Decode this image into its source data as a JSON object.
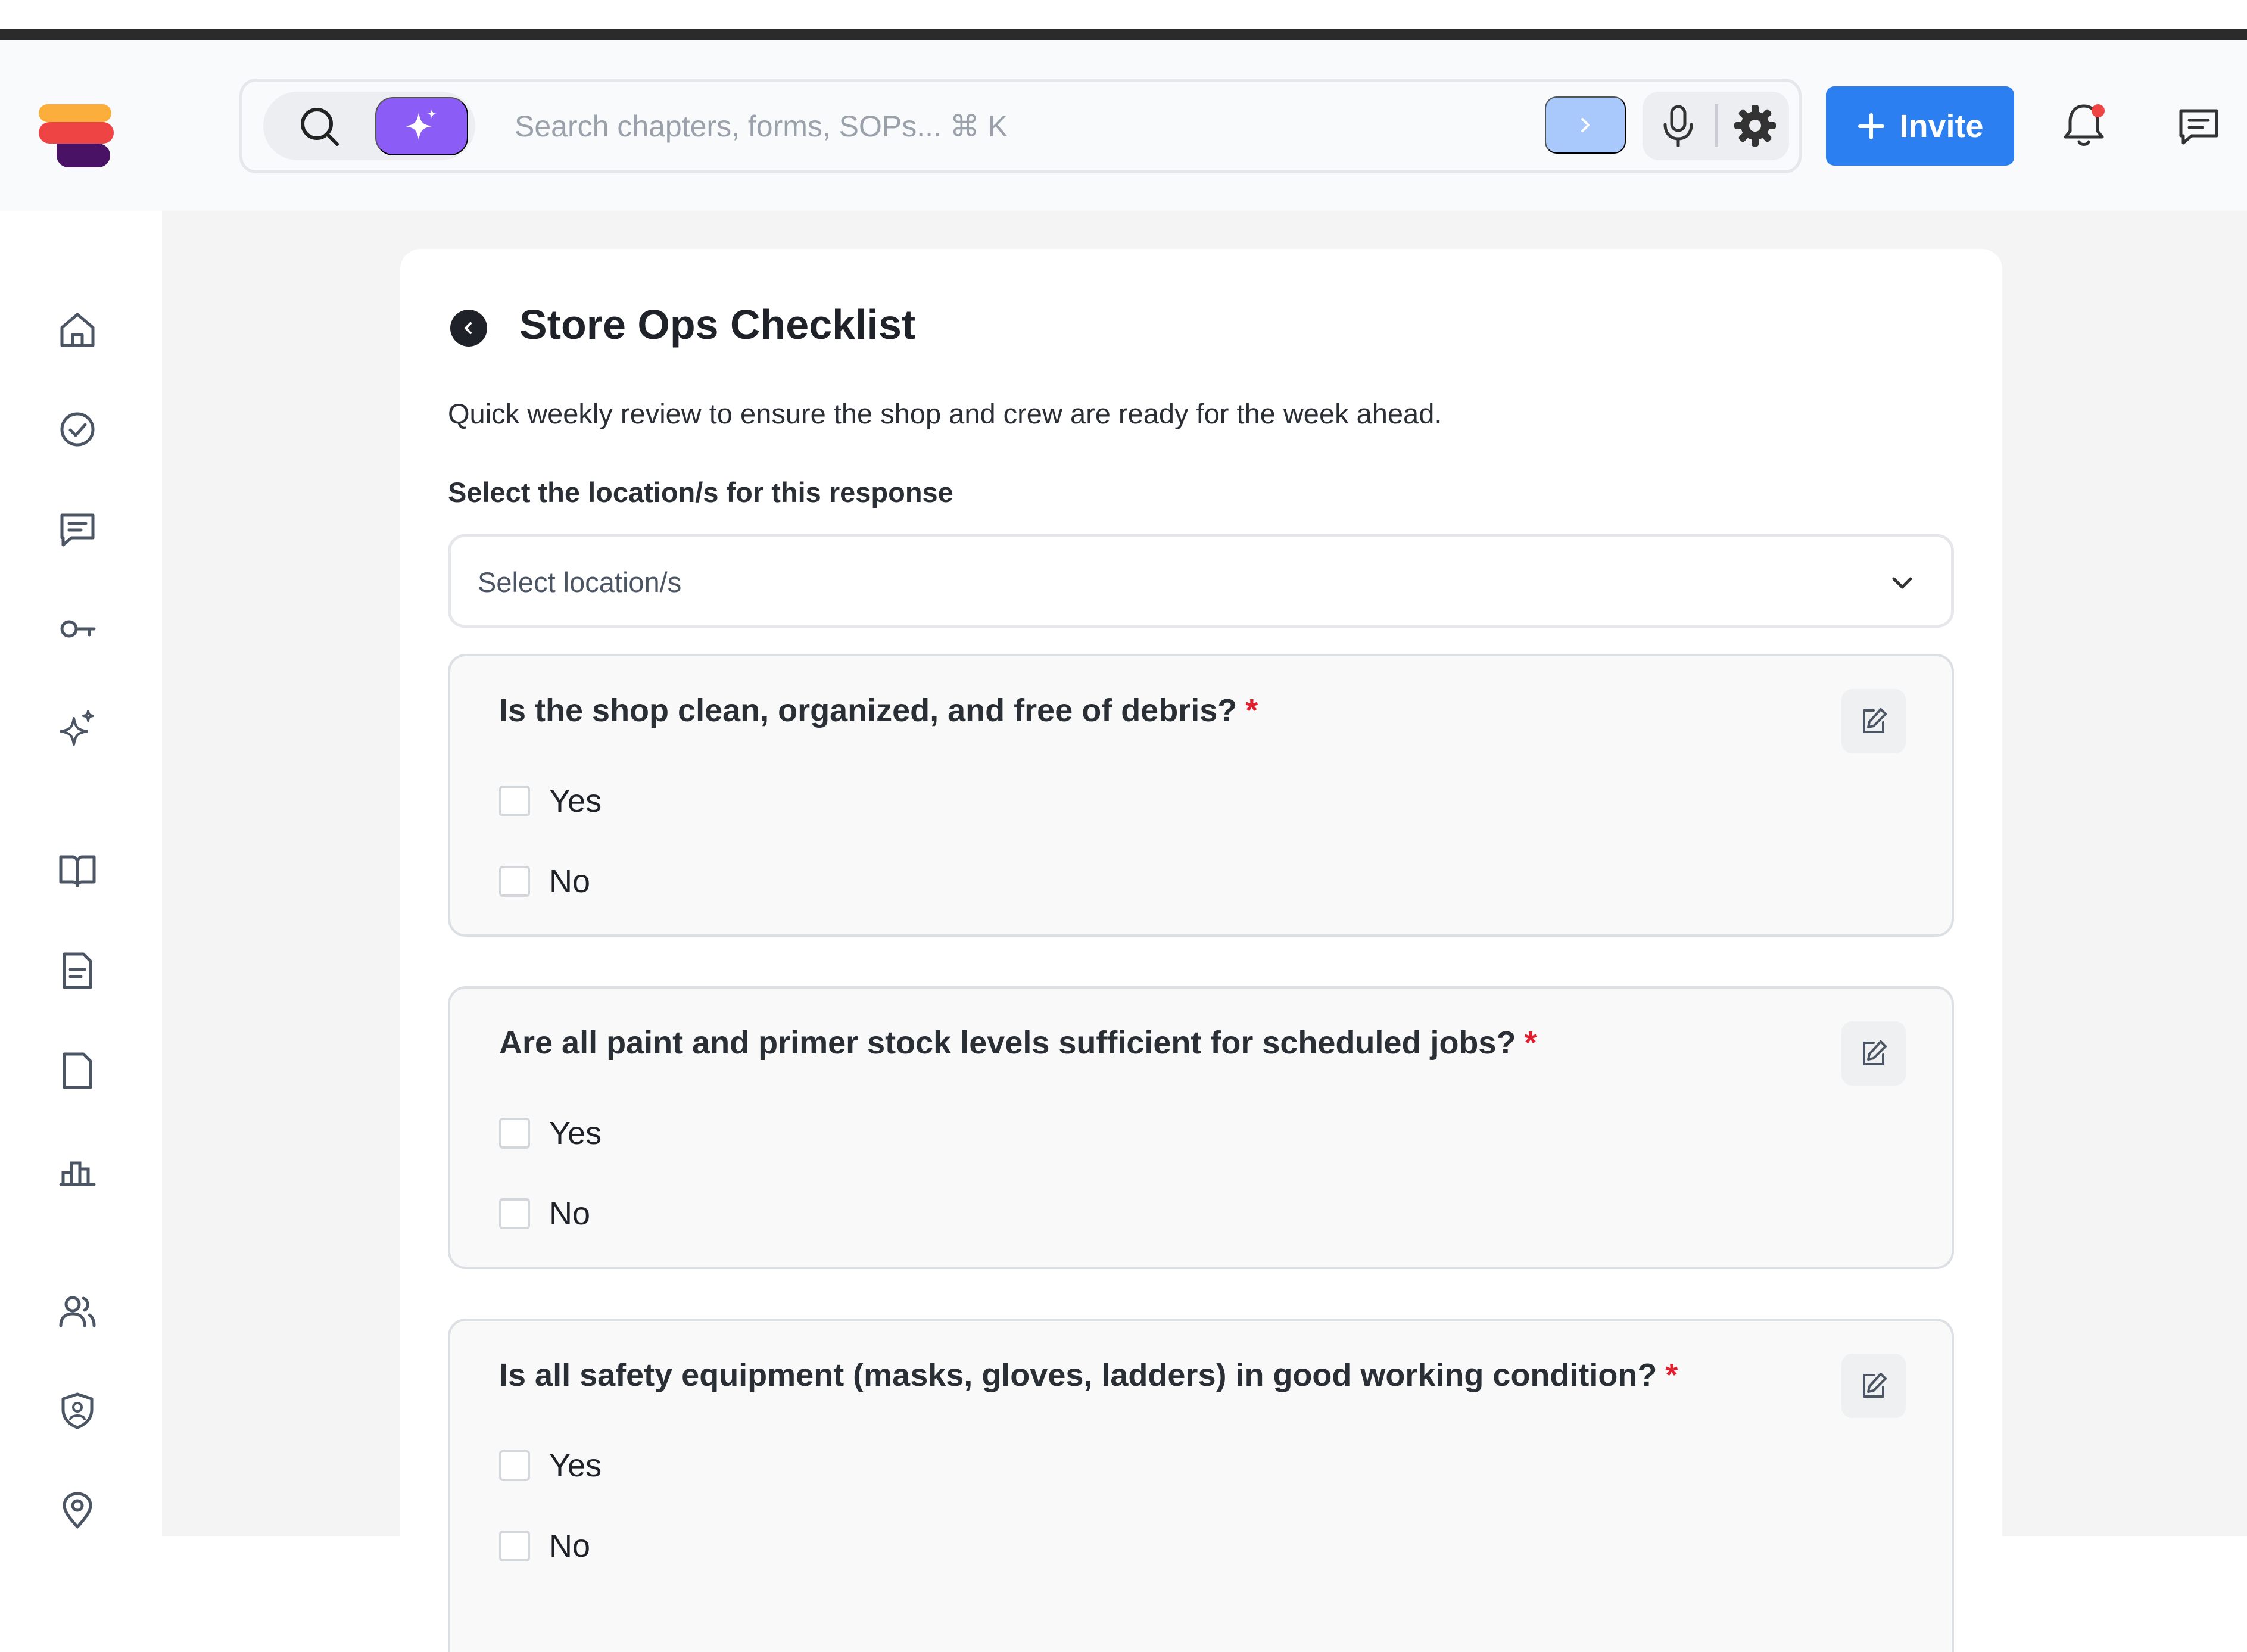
{
  "colors": {
    "accent": "#2b7ff0",
    "ai": "#8b5cf6",
    "required": "#e11d2e",
    "submit_disabled": "#a9c8fb",
    "notification": "#ef4444"
  },
  "icons": {
    "header": [
      "search-icon",
      "sparkle-icon",
      "chevron-right-icon",
      "microphone-icon",
      "gear-icon",
      "plus-icon",
      "bell-icon",
      "message-icon"
    ],
    "sidebar": [
      "home-icon",
      "check-circle-icon",
      "message-icon",
      "key-icon",
      "sparkles-icon",
      "book-icon",
      "file-text-icon",
      "file-icon",
      "chart-icon",
      "users-icon",
      "shield-user-icon",
      "map-pin-icon"
    ]
  },
  "search": {
    "placeholder": "Search chapters, forms, SOPs... ⌘ K"
  },
  "header": {
    "invite_label": "Invite"
  },
  "form": {
    "title": "Store Ops Checklist",
    "description": "Quick weekly review to ensure the shop and crew are ready for the week ahead.",
    "location_label": "Select the location/s for this response",
    "location_placeholder": "Select location/s",
    "questions": [
      {
        "title": "Is the shop clean, organized, and free of debris?",
        "required": "*",
        "options": [
          "Yes",
          "No"
        ]
      },
      {
        "title": "Are all paint and primer stock levels sufficient for scheduled jobs?",
        "required": "*",
        "options": [
          "Yes",
          "No"
        ]
      },
      {
        "title": "Is all safety equipment (masks, gloves, ladders) in good working condition?",
        "required": "*",
        "options": [
          "Yes",
          "No"
        ]
      }
    ]
  }
}
